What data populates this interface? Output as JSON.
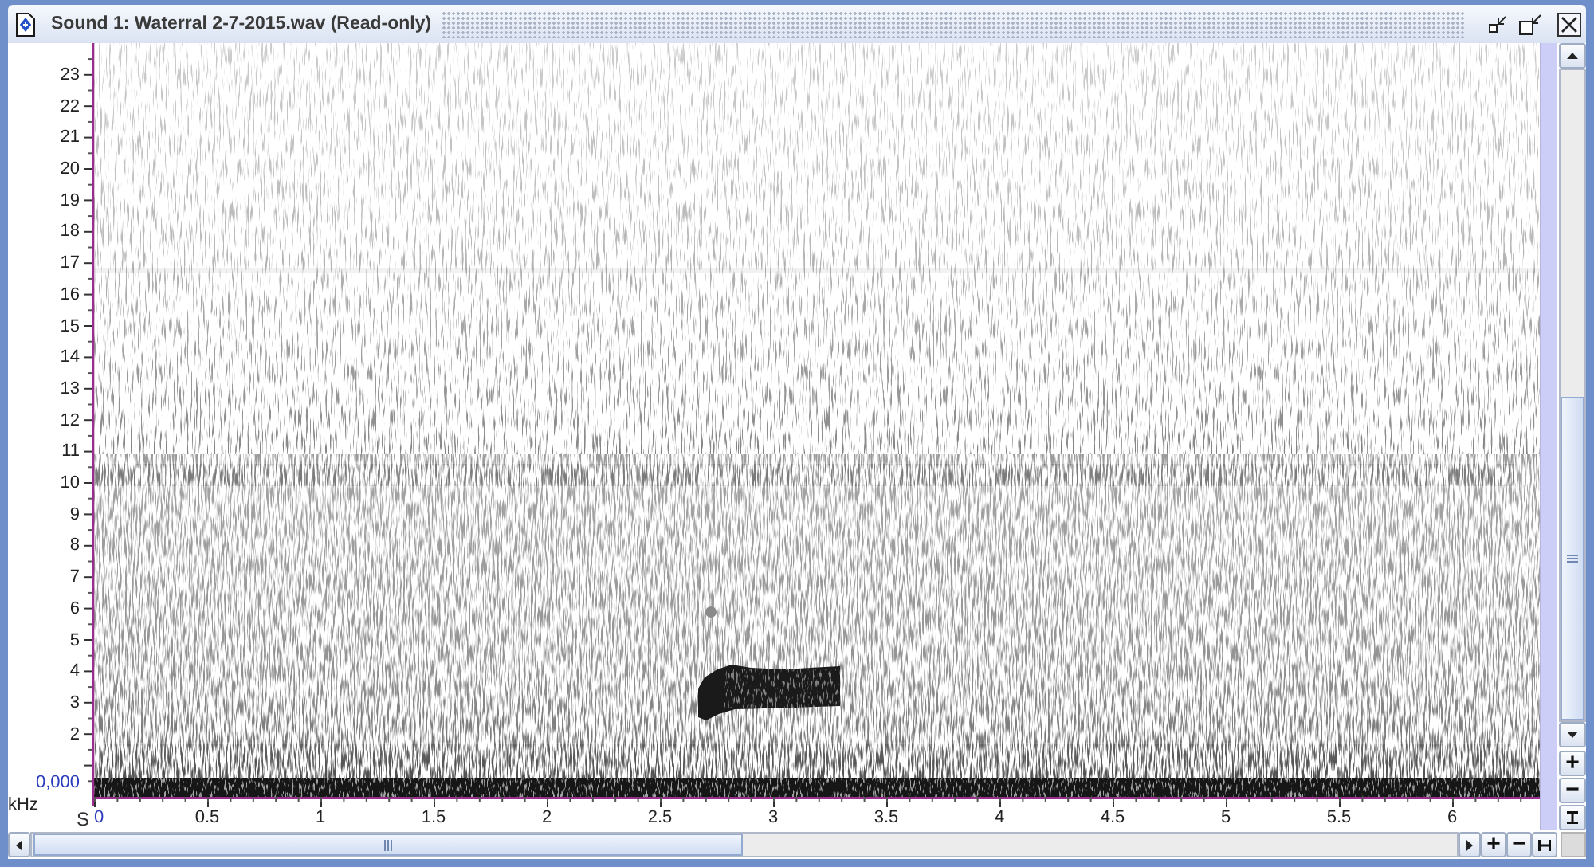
{
  "window": {
    "title": "Sound 1: Waterral 2-7-2015.wav (Read-only)"
  },
  "spectrogram": {
    "y_axis": {
      "unit": "kHz",
      "origin": "0,000",
      "ticks": [
        "23",
        "22",
        "21",
        "20",
        "19",
        "18",
        "17",
        "16",
        "15",
        "14",
        "13",
        "12",
        "11",
        "10",
        "9",
        "8",
        "7",
        "6",
        "5",
        "4",
        "3",
        "2"
      ]
    },
    "x_axis": {
      "unit": "S",
      "origin": "0",
      "ticks": [
        "0.5",
        "1",
        "1.5",
        "2",
        "2.5",
        "3",
        "3.5",
        "4",
        "4.5",
        "5",
        "5.5",
        "6"
      ]
    }
  },
  "vertical_zoom": {
    "buttons": [
      "+",
      "−"
    ]
  },
  "horizontal_zoom": {
    "buttons": [
      "+",
      "−"
    ]
  }
}
